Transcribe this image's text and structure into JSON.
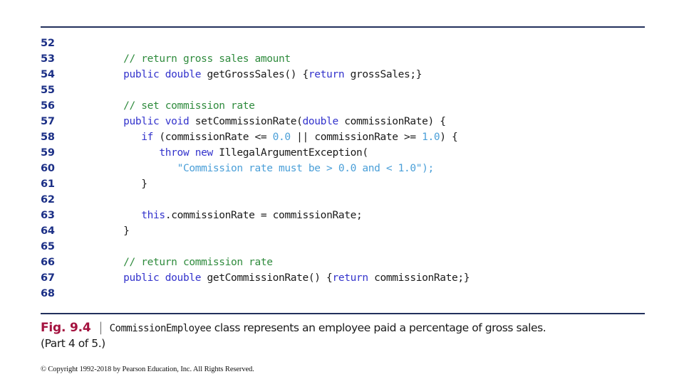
{
  "rules": {
    "top_label": "top-divider",
    "bottom_label": "bottom-divider"
  },
  "listing": {
    "language": "java",
    "first_line": 52,
    "last_line": 68,
    "lines": [
      {
        "no": "52",
        "tokens": []
      },
      {
        "no": "53",
        "tokens": [
          {
            "t": "pl",
            "s": "   "
          },
          {
            "t": "cm",
            "s": "// return gross sales amount"
          }
        ]
      },
      {
        "no": "54",
        "tokens": [
          {
            "t": "pl",
            "s": "   "
          },
          {
            "t": "k",
            "s": "public double"
          },
          {
            "t": "pl",
            "s": " getGrossSales() {"
          },
          {
            "t": "k",
            "s": "return"
          },
          {
            "t": "pl",
            "s": " grossSales;}"
          }
        ]
      },
      {
        "no": "55",
        "tokens": []
      },
      {
        "no": "56",
        "tokens": [
          {
            "t": "pl",
            "s": "   "
          },
          {
            "t": "cm",
            "s": "// set commission rate"
          }
        ]
      },
      {
        "no": "57",
        "tokens": [
          {
            "t": "pl",
            "s": "   "
          },
          {
            "t": "k",
            "s": "public void"
          },
          {
            "t": "pl",
            "s": " setCommissionRate("
          },
          {
            "t": "k",
            "s": "double"
          },
          {
            "t": "pl",
            "s": " commissionRate) {"
          }
        ]
      },
      {
        "no": "58",
        "tokens": [
          {
            "t": "pl",
            "s": "      "
          },
          {
            "t": "k",
            "s": "if"
          },
          {
            "t": "pl",
            "s": " (commissionRate <= "
          },
          {
            "t": "lit",
            "s": "0.0"
          },
          {
            "t": "pl",
            "s": " || commissionRate >= "
          },
          {
            "t": "lit",
            "s": "1.0"
          },
          {
            "t": "pl",
            "s": ") {"
          }
        ]
      },
      {
        "no": "59",
        "tokens": [
          {
            "t": "pl",
            "s": "         "
          },
          {
            "t": "k",
            "s": "throw new"
          },
          {
            "t": "pl",
            "s": " IllegalArgumentException("
          }
        ]
      },
      {
        "no": "60",
        "tokens": [
          {
            "t": "pl",
            "s": "            "
          },
          {
            "t": "lit",
            "s": "\"Commission rate must be > 0.0 and < 1.0\");"
          }
        ]
      },
      {
        "no": "61",
        "tokens": [
          {
            "t": "pl",
            "s": "      }"
          }
        ]
      },
      {
        "no": "62",
        "tokens": []
      },
      {
        "no": "63",
        "tokens": [
          {
            "t": "pl",
            "s": "      "
          },
          {
            "t": "k",
            "s": "this"
          },
          {
            "t": "pl",
            "s": ".commissionRate = commissionRate;"
          }
        ]
      },
      {
        "no": "64",
        "tokens": [
          {
            "t": "pl",
            "s": "   }"
          }
        ]
      },
      {
        "no": "65",
        "tokens": []
      },
      {
        "no": "66",
        "tokens": [
          {
            "t": "pl",
            "s": "   "
          },
          {
            "t": "cm",
            "s": "// return commission rate"
          }
        ]
      },
      {
        "no": "67",
        "tokens": [
          {
            "t": "pl",
            "s": "   "
          },
          {
            "t": "k",
            "s": "public double"
          },
          {
            "t": "pl",
            "s": " getCommissionRate() {"
          },
          {
            "t": "k",
            "s": "return"
          },
          {
            "t": "pl",
            "s": " commissionRate;}"
          }
        ]
      },
      {
        "no": "68",
        "tokens": []
      }
    ]
  },
  "caption": {
    "fig_label": "Fig. 9.4",
    "separator": "|",
    "class_name": "CommissionEmployee",
    "description": " class represents an employee paid a percentage of gross sales.",
    "part_note": "(Part 4 of 5.)"
  },
  "copyright": "© Copyright 1992-2018 by Pearson Education, Inc. All Rights Reserved.",
  "colors": {
    "rule": "#22305c",
    "line_number": "#1b2f86",
    "keyword": "#3333cc",
    "comment": "#2f8b3d",
    "literal": "#4a9fd8",
    "plain": "#1a1a1a",
    "fig_label": "#a4123f",
    "background": "#ffffff"
  }
}
